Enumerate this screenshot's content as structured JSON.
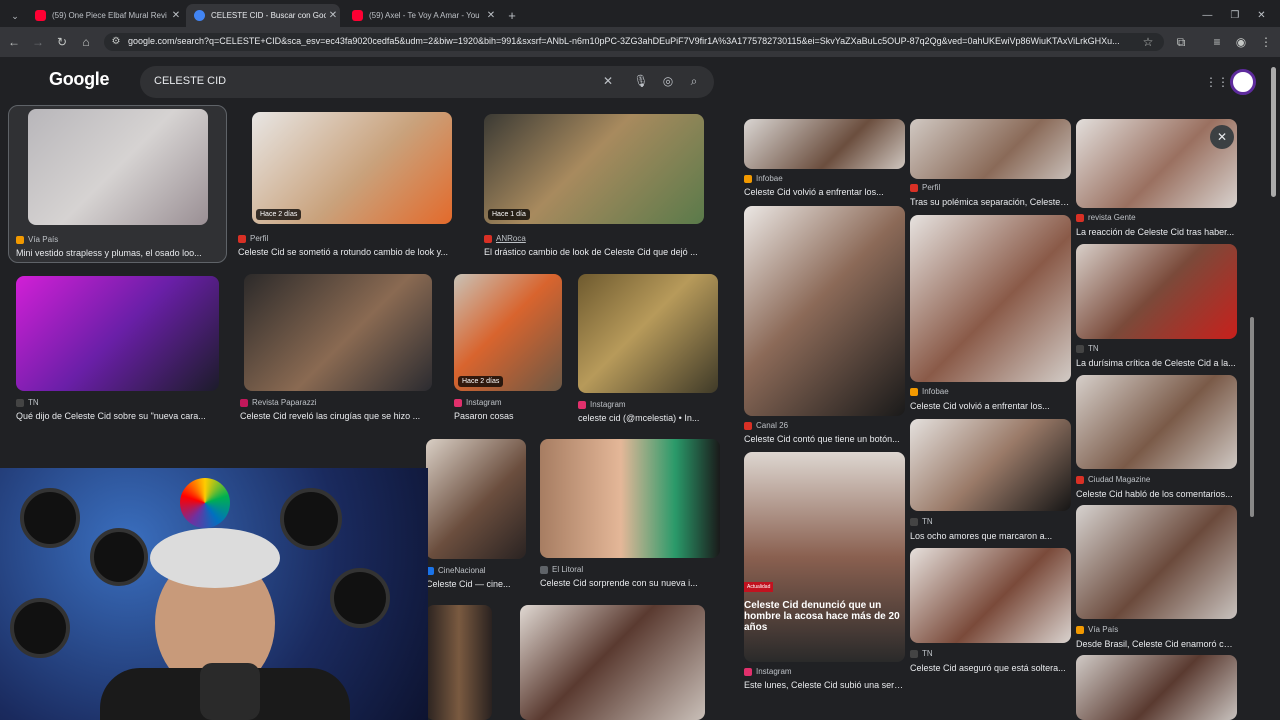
{
  "browser": {
    "tabs": [
      {
        "title": "(59) One Piece Elbaf Mural Revi",
        "favicon_color": "#ff0033",
        "active": false
      },
      {
        "title": "CELESTE CID - Buscar con Goog",
        "favicon_color": "#4285f4",
        "active": true
      },
      {
        "title": "(59) Axel - Te Voy A Amar - You",
        "favicon_color": "#ff0033",
        "active": false
      }
    ],
    "new_tab": "+",
    "url": "google.com/search?q=CELESTE+CID&sca_esv=ec43fa9020cedfa5&udm=2&biw=1920&bih=991&sxsrf=ANbL-n6m10pPC-3ZG3ahDEuPiF7V9fir1A%3A1775782730115&ei=SkvYaZXaBuLc5OUP-87q2Qg&ved=0ahUKEwiVp86WiuKTAxViLrkGHXu..."
  },
  "google": {
    "logo": "Google",
    "query": "CELESTE CID"
  },
  "results_left": [
    {
      "source": "Vía País",
      "caption": "Mini vestido strapless y plumas, el osado loo...",
      "badge": "",
      "src_color": "#f29900"
    },
    {
      "source": "Perfil",
      "caption": "Celeste Cid se sometió a rotundo cambio de look y...",
      "badge": "Hace 2 días",
      "src_color": "#d93025"
    },
    {
      "source": "ANRoca",
      "caption": "El drástico cambio de look de Celeste Cid que dejó ...",
      "badge": "Hace 1 día",
      "src_color": "#d93025"
    },
    {
      "source": "TN",
      "caption": "Qué dijo de Celeste Cid sobre su \"nueva cara...",
      "badge": "",
      "src_color": "#444"
    },
    {
      "source": "Revista Paparazzi",
      "caption": "Celeste Cid reveló las cirugías que se hizo ...",
      "badge": "",
      "src_color": "#c2185b"
    },
    {
      "source": "Instagram",
      "caption": "Pasaron cosas",
      "badge": "Hace 2 días",
      "src_color": "#e1306c"
    },
    {
      "source": "Instagram",
      "caption": "celeste cid (@mcelestia) • In...",
      "badge": "",
      "src_color": "#e1306c"
    },
    {
      "source": "CineNacional",
      "caption": "Celeste Cid — cine...",
      "badge": "",
      "src_color": "#1a73e8"
    },
    {
      "source": "El Litoral",
      "caption": "Celeste Cid sorprende con su nueva i...",
      "badge": "",
      "src_color": "#5f6368"
    }
  ],
  "results_right": [
    {
      "source": "Infobae",
      "caption": "Celeste Cid volvió a enfrentar los...",
      "src_color": "#f29900"
    },
    {
      "source": "Perfil",
      "caption": "Tras su polémica separación, Celeste C...",
      "src_color": "#d93025"
    },
    {
      "source": "revista Gente",
      "caption": "La reacción de Celeste Cid tras haber...",
      "src_color": "#d93025"
    },
    {
      "source": "Infobae",
      "caption": "Celeste Cid volvió a enfrentar los...",
      "src_color": "#f29900"
    },
    {
      "source": "TN",
      "caption": "La durísima crítica de Celeste Cid a la...",
      "src_color": "#444"
    },
    {
      "source": "Canal 26",
      "caption": "Celeste Cid contó que tiene un botón...",
      "src_color": "#d93025"
    },
    {
      "source": "TN",
      "caption": "Los ocho amores que marcaron a...",
      "src_color": "#444"
    },
    {
      "source": "Ciudad Magazine",
      "caption": "Celeste Cid habló de los comentarios...",
      "src_color": "#d93025"
    },
    {
      "source": "Instagram",
      "caption": "Este lunes, Celeste Cid subió una serie...",
      "src_color": "#e1306c"
    },
    {
      "source": "TN",
      "caption": "Celeste Cid aseguró que está soltera...",
      "src_color": "#444"
    },
    {
      "source": "Vía País",
      "caption": "Desde Brasil, Celeste Cid enamoró con...",
      "src_color": "#f29900"
    }
  ],
  "overlay": {
    "tag": "Actualidad",
    "headline": "Celeste Cid denunció que un hombre la acosa hace más de 20 años"
  },
  "close_icon": "✕"
}
